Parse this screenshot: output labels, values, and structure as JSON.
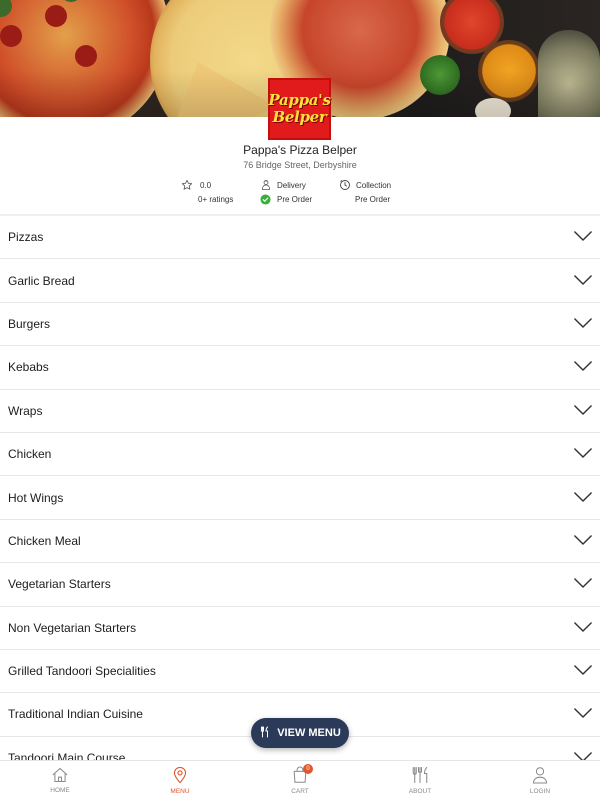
{
  "restaurant": {
    "logo_line1": "Pappa's",
    "logo_line2": "Belper",
    "name": "Pappa's Pizza Belper",
    "address": "76 Bridge Street, Derbyshire",
    "rating": "0.0",
    "ratings_count": "0+ ratings",
    "delivery_label": "Delivery",
    "delivery_status": "Pre Order",
    "collection_label": "Collection",
    "collection_status": "Pre Order"
  },
  "categories": [
    "Pizzas",
    "Garlic Bread",
    "Burgers",
    "Kebabs",
    "Wraps",
    "Chicken",
    "Hot Wings",
    "Chicken Meal",
    "Vegetarian Starters",
    "Non Vegetarian Starters",
    "Grilled Tandoori Specialities",
    "Traditional Indian Cuisine",
    "Tandoori Main Course"
  ],
  "view_menu_label": "VIEW MENU",
  "bottom_nav": {
    "home": "HOME",
    "menu": "MENU",
    "cart": "CART",
    "cart_count": "0",
    "about": "ABOUT",
    "login": "LOGIN"
  },
  "colors": {
    "accent": "#e0562f",
    "button_bg": "#2c3a5a",
    "logo_bg": "#e11b1b",
    "logo_text": "#ffe23a",
    "check_green": "#3aae3a"
  },
  "icons": {
    "rating": "star-icon",
    "delivery": "delivery-person-icon",
    "collection": "clock-icon",
    "status": "check-circle-icon",
    "category": "chevron-down-icon",
    "view_menu": "cutlery-icon",
    "home": "home-icon",
    "menu": "location-pin-icon",
    "cart": "shopping-bag-icon",
    "about": "cutlery-icon",
    "login": "user-icon"
  }
}
